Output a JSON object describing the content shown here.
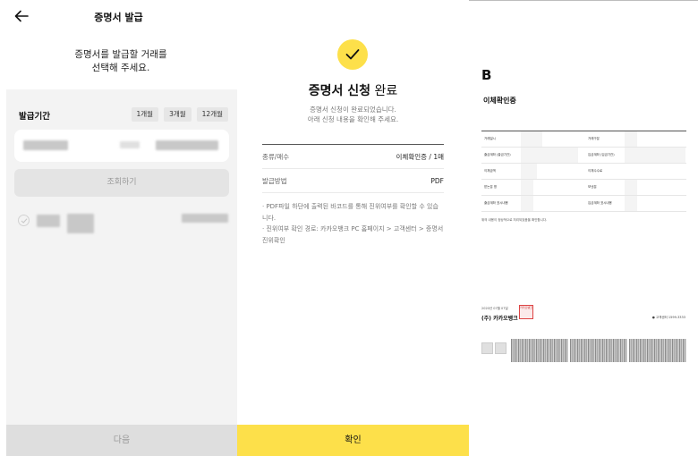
{
  "select_panel": {
    "title": "증명서 발급",
    "prompt_line1": "증명서를 발급할 거래를",
    "prompt_line2": "선택해 주세요.",
    "period_label": "발급기간",
    "period_options": [
      "1개월",
      "3개월",
      "12개월"
    ],
    "inquiry_button": "조회하기",
    "next_button": "다음"
  },
  "done_panel": {
    "title_main": "증명서 신청",
    "title_suffix": "완료",
    "subtitle_line1": "증명서 신청이 완료되었습니다.",
    "subtitle_line2": "아래 신청 내용을 확인해 주세요.",
    "rows": [
      {
        "key": "종류/매수",
        "value": "이체확인증 / 1매"
      },
      {
        "key": "발급방법",
        "value": "PDF"
      }
    ],
    "notes": [
      "· PDF파일 하단에 출력된 바코드를 통해 진위여부를 확인할 수 있습니다.",
      "· 진위여부 확인 경로: 카카오뱅크 PC 홈페이지 > 고객센터 > 증명서 진위확인"
    ],
    "confirm_button": "확인"
  },
  "document_preview": {
    "logo_text": "B",
    "doc_title": "이체확인증",
    "table_labels_left": [
      "거래일시",
      "출금계좌 (출금기관)",
      "이체금액",
      "받는분 명",
      "출금계좌 표시내용"
    ],
    "table_labels_right": [
      "거래구분",
      "입금계좌 (입금기관)",
      "이체수수료",
      "보낸분",
      "입금계좌 표시내용"
    ],
    "footer_note": "위의 내용이 정상적으로 처리되었음을 확인합니다.",
    "issue_date": "2020년 07월 07일",
    "bank_name": "(주) 카카오뱅크",
    "seal_text": "카카오뱅크",
    "contact": "고객센터 1599-3333"
  },
  "colors": {
    "accent_yellow": "#fde04a",
    "panel_gray": "#f3f3f3",
    "disabled_button": "#dedede"
  },
  "icons": [
    "back-arrow-icon",
    "checkmark-icon",
    "radio-check-icon"
  ]
}
